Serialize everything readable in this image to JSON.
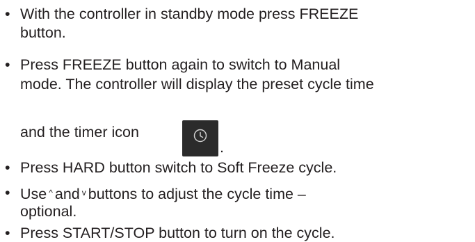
{
  "items": [
    {
      "lines": [
        "With the controller in standby mode press FREEZE",
        "button."
      ]
    },
    {
      "lines": [
        "Press FREEZE button again to switch to Manual",
        "mode. The controller will display the preset cycle time",
        "and the timer icon"
      ],
      "trailing": "."
    },
    {
      "lines": [
        "Press HARD button switch to Soft Freeze cycle."
      ]
    },
    {
      "parts": [
        "Use",
        "^",
        "and",
        "v",
        "buttons to adjust the cycle time –"
      ],
      "lines": [
        "optional."
      ]
    },
    {
      "lines": [
        "Press START/STOP button to turn on the cycle."
      ]
    }
  ],
  "bullet_char": "•",
  "icons": {
    "timer": "timer-icon"
  },
  "colors": {
    "text": "#231f20",
    "icon_bg": "#2b2b2b",
    "icon_stroke": "#cfcfcf"
  }
}
